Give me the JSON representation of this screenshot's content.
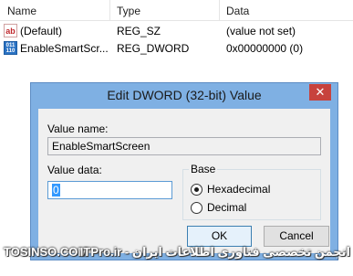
{
  "list": {
    "columns": [
      "Name",
      "Type",
      "Data"
    ],
    "rows": [
      {
        "icon": "string-value-icon",
        "name": "(Default)",
        "type": "REG_SZ",
        "data": "(value not set)"
      },
      {
        "icon": "binary-value-icon",
        "name": "EnableSmartScr...",
        "type": "REG_DWORD",
        "data": "0x00000000 (0)"
      }
    ]
  },
  "dialog": {
    "title": "Edit DWORD (32-bit) Value",
    "close_glyph": "✕",
    "value_name_label": "Value name:",
    "value_name": "EnableSmartScreen",
    "value_data_label": "Value data:",
    "value_data": "0",
    "base_label": "Base",
    "base_options": [
      {
        "label": "Hexadecimal",
        "selected": true
      },
      {
        "label": "Decimal",
        "selected": false
      }
    ],
    "ok_label": "OK",
    "cancel_label": "Cancel"
  },
  "watermark": {
    "left": "TOSINSO.COM",
    "right": "انجمن تخصصی فناوری اطلاعات ایران - ITPro.ir"
  },
  "colors": {
    "title_bar": "#7fb0e3",
    "close_button": "#c7423d",
    "selection": "#3399ff"
  }
}
